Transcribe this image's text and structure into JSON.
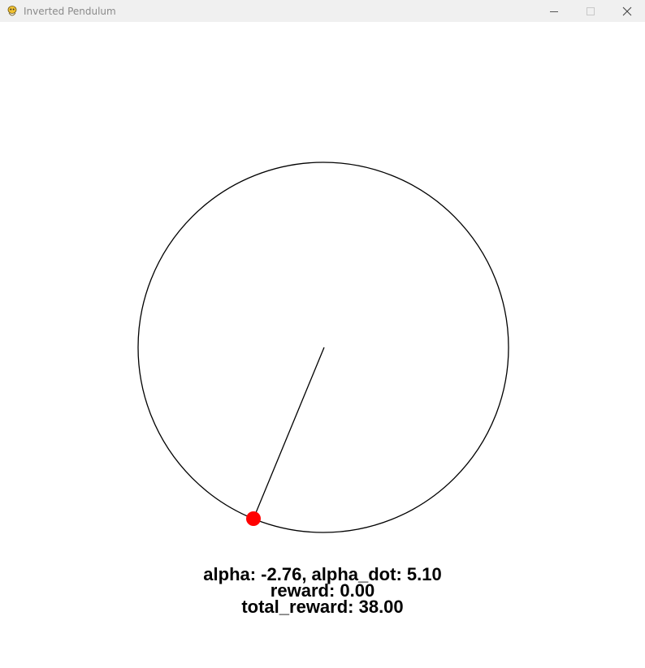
{
  "window": {
    "title": "Inverted Pendulum"
  },
  "icons": {
    "app": "pygame-snake-icon",
    "minimize": "minimize-icon",
    "maximize": "maximize-icon",
    "close": "close-icon"
  },
  "colors": {
    "bob": "#ff0000",
    "rod": "#000000",
    "track": "#000000",
    "background": "#ffffff"
  },
  "state": {
    "alpha_line": "alpha: -2.76, alpha_dot: 5.10",
    "reward_line": "reward: 0.00",
    "total_reward_line": "total_reward: 38.00"
  }
}
